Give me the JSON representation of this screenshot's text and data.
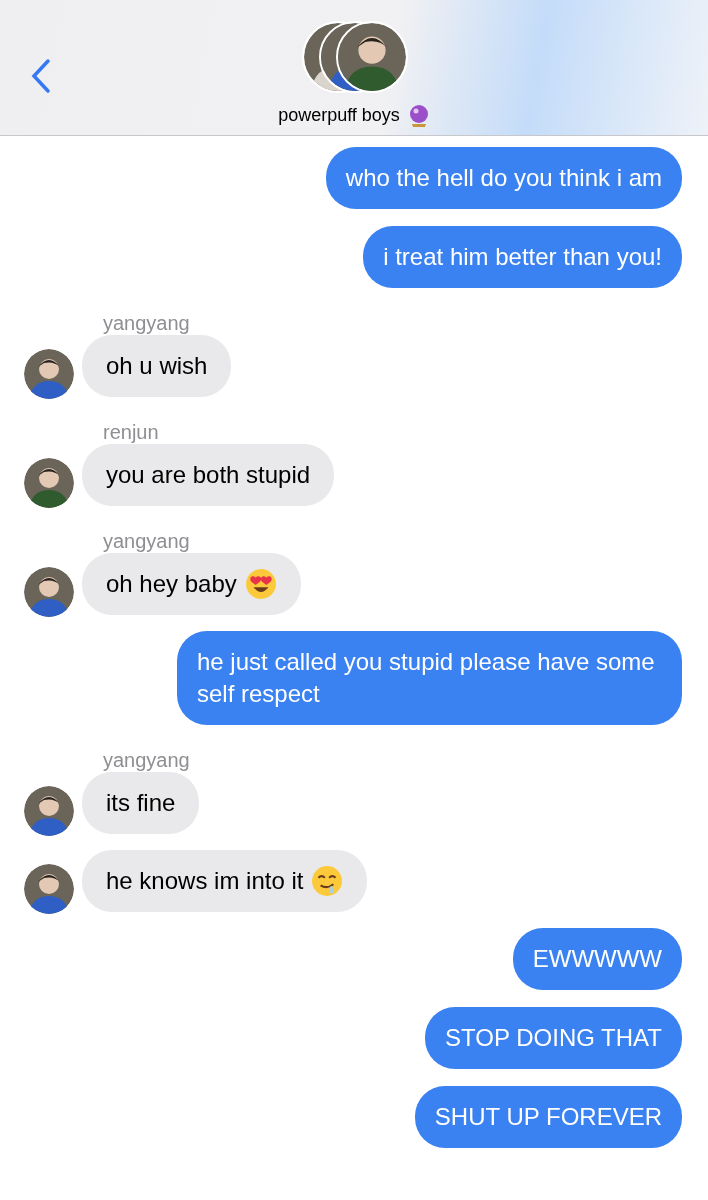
{
  "header": {
    "title": "powerpuff boys",
    "title_icon": {
      "kind": "crystal_ball"
    }
  },
  "messages": [
    {
      "kind": "outgoing",
      "text": "who the hell do you think i am"
    },
    {
      "kind": "outgoing",
      "text": "i treat him better than you!"
    },
    {
      "kind": "incoming",
      "sender": "yangyang",
      "color": "#2f5fc4",
      "text": "oh u wish"
    },
    {
      "kind": "incoming",
      "sender": "renjun",
      "color": "#2f5b2f",
      "text": "you are both stupid"
    },
    {
      "kind": "incoming",
      "sender": "yangyang",
      "color": "#2f5fc4",
      "text": "oh hey baby",
      "emoji": {
        "kind": "heart_eyes"
      }
    },
    {
      "kind": "outgoing",
      "text": "he just called you stupid please have some self respect"
    },
    {
      "kind": "incoming",
      "sender": "yangyang",
      "color": "#2f5fc4",
      "text": "its fine"
    },
    {
      "kind": "incoming",
      "color": "#2f5fc4",
      "text": "he knows im into it",
      "emoji": {
        "kind": "drooling"
      }
    },
    {
      "kind": "outgoing",
      "text": "EWWWWW"
    },
    {
      "kind": "outgoing",
      "text": "STOP DOING THAT"
    },
    {
      "kind": "outgoing",
      "text": "SHUT UP FOREVER"
    }
  ]
}
